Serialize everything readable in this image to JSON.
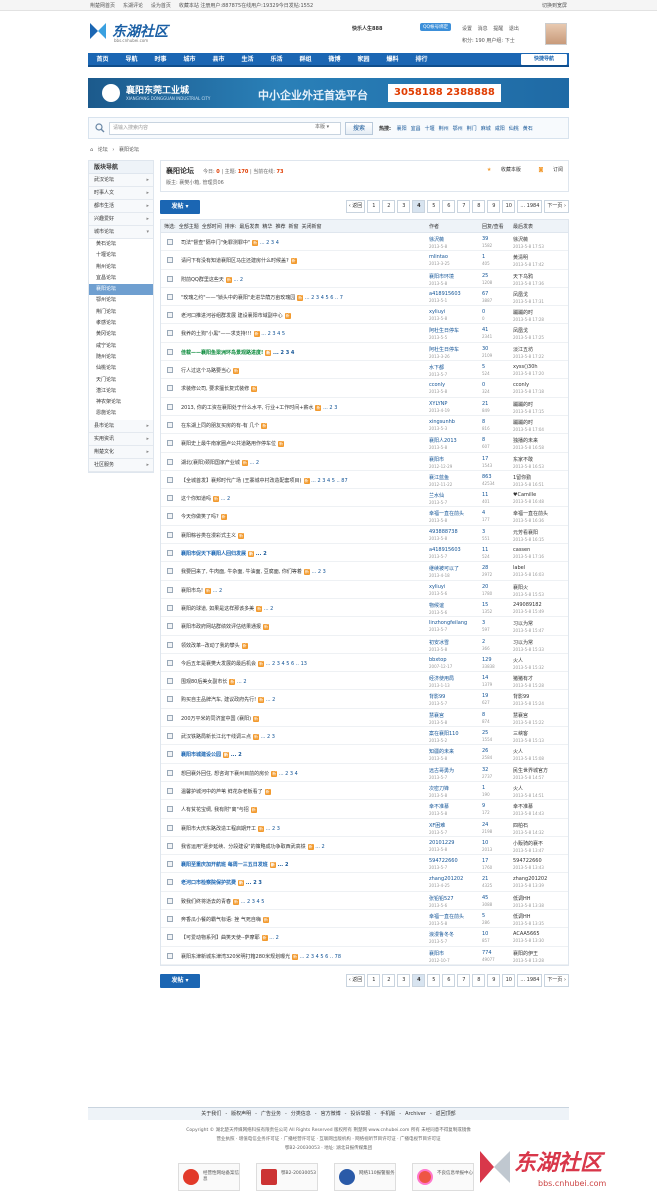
{
  "topbar": {
    "links": [
      "荆楚网首页",
      "东湖评论",
      "设为首页",
      "收藏本站 注册用户:887875在线用户:19329今日发帖:1552"
    ],
    "right": "切换到宽屏"
  },
  "logo": {
    "brand": "东湖社区",
    "sub": "bbs.cnhubei.com"
  },
  "user": {
    "name": "快乐人生888",
    "qq": "QQ帐号绑定",
    "links": [
      "设置",
      "消息",
      "提醒",
      "退出"
    ],
    "score": "积分: 190",
    "group": "用户组: 下士"
  },
  "nav": {
    "items": [
      "首页",
      "导航",
      "时事",
      "城市",
      "县市",
      "生活",
      "乐活",
      "群组",
      "微博",
      "家园",
      "爆料",
      "排行"
    ],
    "quick": "快捷导航"
  },
  "banner": {
    "name": "襄阳东莞工业城",
    "name_en": "XIANGYANG DONGGUAN INDUSTRIAL CITY",
    "slogan": "中小企业外迁首选平台",
    "phone": "3058188 2388888"
  },
  "search": {
    "placeholder": "请输入搜索内容",
    "scope": "本版",
    "button": "搜索",
    "hot_label": "热搜:",
    "hot": [
      "襄阳",
      "宜昌",
      "十堰",
      "荆州",
      "鄂州",
      "荆门",
      "麻城",
      "咸阳",
      "仙桃",
      "黄石"
    ]
  },
  "breadcrumb": [
    "论坛",
    "›",
    "襄阳论坛"
  ],
  "sidebar": {
    "title": "版块导航",
    "groups": [
      "武汉论坛",
      "时事人文",
      "都市生活",
      "兴趣爱好",
      "城市论坛"
    ],
    "subs": [
      "黄石论坛",
      "十堰论坛",
      "荆州论坛",
      "宜昌论坛",
      "襄阳论坛",
      "鄂州论坛",
      "荆门论坛",
      "孝感论坛",
      "黄冈论坛",
      "咸宁论坛",
      "随州论坛",
      "仙桃论坛",
      "天门论坛",
      "潜江论坛",
      "神农架论坛",
      "恩施论坛"
    ],
    "groups2": [
      "县市论坛",
      "实用资讯",
      "荆楚文化",
      "社区服务"
    ]
  },
  "forum": {
    "title": "襄阳论坛",
    "today_label": "今日:",
    "today": "0",
    "topics_label": "主题:",
    "topics": "170",
    "online_label": "当前在线:",
    "online": "73",
    "mods": "版主: 襄樊小箱, 管理员06",
    "fav": "收藏本版",
    "rss": "订阅"
  },
  "actions": {
    "post": "发帖",
    "pager": [
      "‹ 返回",
      "1",
      "2",
      "3",
      "4",
      "5",
      "6",
      "7",
      "8",
      "9",
      "10",
      "... 1984",
      "下一页 ›"
    ],
    "current_page": "4"
  },
  "thead": {
    "filters": [
      "筛选:",
      "全部主题",
      "全部时间",
      "排序:",
      "最后发表",
      "精华",
      "推荐",
      "新窗"
    ],
    "close": "关闭新窗",
    "author": "作者",
    "reply": "回复/查看",
    "last": "最后发表"
  },
  "threads": [
    {
      "title": "司法\"督查\"隔中门\"免罪测罪中\"",
      "pages": "... 2  3  4",
      "style": "",
      "author": "徐沢薇",
      "date": "2013-5-8",
      "replies": "39",
      "views": "1582",
      "last": "徐沢薇",
      "last_date": "2013-5-8 17:53"
    },
    {
      "title": "请问下有没有知道襄阳区马庄还建房什么时候盖?",
      "pages": "",
      "style": "",
      "author": "mlintao",
      "date": "2013-3-25",
      "replies": "1",
      "views": "405",
      "last": "黄清明",
      "last_date": "2013-5-8 17:42"
    },
    {
      "title": "附前QQ群里这些天",
      "pages": "... 2",
      "style": "",
      "author": "襄阳市环境",
      "date": "2013-5-8",
      "replies": "25",
      "views": "1208",
      "last": "天下乌鸦",
      "last_date": "2013-5-8 17:36"
    },
    {
      "title": "\"玫瑰之约\"——\"锁头中的襄阳\"走进华荫万亩玫瑰园",
      "pages": "... 2  3  4  5  6 .. 7",
      "style": "",
      "author": "a418915603",
      "date": "2013-5-1",
      "replies": "67",
      "views": "3887",
      "last": "凤凰戈",
      "last_date": "2013-5-8 17:31"
    },
    {
      "title": "老河口推进河谷组群发展 建设襄阳市域副中心",
      "pages": "",
      "style": "",
      "author": "xyliuyi",
      "date": "2013-5-8",
      "replies": "0",
      "views": "0",
      "last": "蹦蹦的时",
      "last_date": "2013-5-8 17:28"
    },
    {
      "title": "我养的土狗\"小黑\"——求支持!!!",
      "pages": "... 2  3  4  5",
      "style": "",
      "author": "阿杜生日停车",
      "date": "2013-5-5",
      "replies": "41",
      "views": "2341",
      "last": "凤凰戈",
      "last_date": "2013-5-8 17:25"
    },
    {
      "title": "佳载——襄阳鱼梁洲环岛景观路进度!",
      "pages": "... 2  3  4",
      "style": "hl",
      "author": "阿杜生日停车",
      "date": "2013-3-26",
      "replies": "30",
      "views": "2109",
      "last": "淡江五坊",
      "last_date": "2013-5-8 17:22"
    },
    {
      "title": "行人过这个马路要当心",
      "pages": "",
      "style": "",
      "author": "水下都",
      "date": "2013-5-7",
      "replies": "5",
      "views": "524",
      "last": "xyss()30h",
      "last_date": "2013-5-8 17:20"
    },
    {
      "title": "求装修公司, 要求擅长复式装修",
      "pages": "",
      "style": "",
      "author": "cconly",
      "date": "2013-5-8",
      "replies": "0",
      "views": "324",
      "last": "cconly",
      "last_date": "2013-5-8 17:18"
    },
    {
      "title": "2013, 你的工资在襄阳处于什么水平, 行业+工作时间+薪水",
      "pages": "... 2  3",
      "style": "",
      "author": "XYLYNP",
      "date": "2013-4-19",
      "replies": "21",
      "views": "849",
      "last": "蹦蹦的时",
      "last_date": "2013-5-8 17:15"
    },
    {
      "title": "在东湖上同的朋友买房的有-有 几个",
      "pages": "",
      "style": "",
      "author": "xingsunhb",
      "date": "2013-5-3",
      "replies": "8",
      "views": "816",
      "last": "蹦蹦的时",
      "last_date": "2013-5-8 17:04"
    },
    {
      "title": "襄阳史上最牛南家圈卢公共道路用作停车位",
      "pages": "",
      "style": "",
      "author": "襄阳人2013",
      "date": "2013-5-8",
      "replies": "8",
      "views": "607",
      "last": "独播的未来",
      "last_date": "2013-5-8 16:58"
    },
    {
      "title": "湖北(襄阳)颈阳国家产业城",
      "pages": "... 2",
      "style": "",
      "author": "襄阳市",
      "date": "2012-12-29",
      "replies": "17",
      "views": "1543",
      "last": "东家不敢",
      "last_date": "2013-5-8 16:53"
    },
    {
      "title": "【全城首发】襄邦时代广场 (王寨城中村改造配套项目)",
      "pages": "... 2  3  4  5 .. 87",
      "style": "",
      "author": "襄江蓝鱼",
      "date": "2012-11-22",
      "replies": "863",
      "views": "42534",
      "last": "1留你勤",
      "last_date": "2013-5-8 16:51"
    },
    {
      "title": "这个你知道吗",
      "pages": "... 2",
      "style": "",
      "author": "兰水仙",
      "date": "2013-5-7",
      "replies": "11",
      "views": "401",
      "last": "♥Camille",
      "last_date": "2013-5-8 16:48"
    },
    {
      "title": "今天你做笑了吗?",
      "pages": "",
      "style": "",
      "author": "幸福一直在前头",
      "date": "2013-5-8",
      "replies": "4",
      "views": "177",
      "last": "幸福一直在前头",
      "last_date": "2013-5-8 16:36"
    },
    {
      "title": "襄阳粽谷类在漫彩式主义",
      "pages": "",
      "style": "",
      "author": "493888738",
      "date": "2013-5-8",
      "replies": "3",
      "views": "551",
      "last": "元芳看襄阳",
      "last_date": "2013-5-8 16:15"
    },
    {
      "title": "襄阳市促天下襄阳人回归发展",
      "pages": "... 2",
      "style": "bl",
      "author": "a418915603",
      "date": "2013-5-7",
      "replies": "11",
      "views": "524",
      "last": "cassen",
      "last_date": "2013-5-8 17:16"
    },
    {
      "title": "我要回来了, 牛肉面, 牛杂面, 牛油面, 豆腐面, 你们等着",
      "pages": "... 2  3",
      "style": "",
      "author": "继续被可以了",
      "date": "2013-4-18",
      "replies": "28",
      "views": "2972",
      "last": "label",
      "last_date": "2013-5-8 16:03"
    },
    {
      "title": "襄阳市鸟!",
      "pages": "... 2",
      "style": "",
      "author": "xyliuyi",
      "date": "2013-5-6",
      "replies": "20",
      "views": "1780",
      "last": "襄阳火",
      "last_date": "2013-5-8 15:53"
    },
    {
      "title": "襄阳的球道, 如果是这样那该多美",
      "pages": "... 2",
      "style": "",
      "author": "物候谊",
      "date": "2013-5-6",
      "replies": "15",
      "views": "1352",
      "last": "249089182",
      "last_date": "2013-5-8 15:49"
    },
    {
      "title": "襄阳市政府网站群绩效评估结果通报",
      "pages": "",
      "style": "",
      "author": "linzhongfeilang",
      "date": "2013-5-7",
      "replies": "3",
      "views": "597",
      "last": "习以为常",
      "last_date": "2013-5-8 15:47"
    },
    {
      "title": "领效改革--改动了我的攀头",
      "pages": "",
      "style": "",
      "author": "初安冰雪",
      "date": "2013-5-8",
      "replies": "2",
      "views": "366",
      "last": "习以为常",
      "last_date": "2013-5-8 15:33"
    },
    {
      "title": "今后五年是襄樊大发展的最后机会",
      "pages": "... 2  3  4  5  6 .. 13",
      "style": "",
      "author": "bbxtop",
      "date": "2007-12-17",
      "replies": "129",
      "views": "33838",
      "last": "火人",
      "last_date": "2013-5-8 15:32"
    },
    {
      "title": "围观80后美女副市长",
      "pages": "... 2",
      "style": "",
      "author": "经济使用局",
      "date": "2013-1-13",
      "replies": "14",
      "views": "1379",
      "last": "猪猪有才",
      "last_date": "2013-5-8 15:28"
    },
    {
      "title": "购买自主品牌汽车, 建议政府先行!",
      "pages": "... 2",
      "style": "",
      "author": "背影99",
      "date": "2013-5-7",
      "replies": "19",
      "views": "627",
      "last": "背影99",
      "last_date": "2013-5-8 15:24"
    },
    {
      "title": "200万平米的同济室中国 (襄阳)",
      "pages": "",
      "style": "",
      "author": "慧襄宫",
      "date": "2013-5-8",
      "replies": "8",
      "views": "874",
      "last": "慧襄宫",
      "last_date": "2013-5-8 15:22"
    },
    {
      "title": "武汉铁路局新长江北干线调三点",
      "pages": "... 2  3",
      "style": "",
      "author": "案在襄阳110",
      "date": "2013-5-2",
      "replies": "25",
      "views": "1554",
      "last": "三峡客",
      "last_date": "2013-5-8 15:13"
    },
    {
      "title": "襄阳市城建设公园",
      "pages": "... 2",
      "style": "bl",
      "author": "知疆的未来",
      "date": "2013-5-8",
      "replies": "26",
      "views": "2584",
      "last": "火人",
      "last_date": "2013-5-8 15:08"
    },
    {
      "title": "想回襄外回住, 想咨询下襄州目前的房价",
      "pages": "... 2  3  4",
      "style": "",
      "author": "远古哥勇为",
      "date": "2013-5-7",
      "replies": "32",
      "views": "2737",
      "last": "民生世界城官方",
      "last_date": "2013-5-8 14:57"
    },
    {
      "title": "温馨护城河中的芦苇 鲜花杂老板看了",
      "pages": "",
      "style": "",
      "author": "次密刀锋",
      "date": "2013-5-8",
      "replies": "1",
      "views": "190",
      "last": "火人",
      "last_date": "2013-5-8 14:51"
    },
    {
      "title": "人有贫花宝绸, 我有附\"离\"与招",
      "pages": "",
      "style": "",
      "author": "幸不准慕",
      "date": "2013-5-8",
      "replies": "9",
      "views": "172",
      "last": "幸不准慕",
      "last_date": "2013-5-8 14:43"
    },
    {
      "title": "襄阳市大庆东路改造工程启期开工",
      "pages": "... 2  3",
      "style": "",
      "author": "XF困难",
      "date": "2013-5-7",
      "replies": "24",
      "views": "2198",
      "last": "四柏石",
      "last_date": "2013-5-8 14:32"
    },
    {
      "title": "我省运用\"逐步延续、分段建设\"的策略成功争取西武高铁",
      "pages": "... 2",
      "style": "",
      "author": "20101229",
      "date": "2013-5-8",
      "replies": "10",
      "views": "2013",
      "last": "小贩骑的襄不",
      "last_date": "2013-5-8 13:47"
    },
    {
      "title": "襄阳至重庆加开航班 每周一三五日发班",
      "pages": "... 2",
      "style": "bl",
      "author": "594722660",
      "date": "2013-5-7",
      "replies": "17",
      "views": "1760",
      "last": "594722660",
      "last_date": "2013-5-8 13:43"
    },
    {
      "title": "老河口市检察院保护抗费",
      "pages": "... 2  3",
      "style": "bld",
      "author": "zhang201202",
      "date": "2013-4-25",
      "replies": "21",
      "views": "4325",
      "last": "zhang201202",
      "last_date": "2013-5-8 13:39"
    },
    {
      "title": "致我们终将逝去的青春",
      "pages": "... 2  3  4  5",
      "style": "",
      "author": "张铅铅527",
      "date": "2013-5-6",
      "replies": "45",
      "views": "3088",
      "last": "低调HH",
      "last_date": "2013-5-8 13:38"
    },
    {
      "title": "奔香瓜小餐的霸气标语: 挫 气死自嗨",
      "pages": "",
      "style": "",
      "author": "幸福一直在前头",
      "date": "2013-5-8",
      "replies": "5",
      "views": "286",
      "last": "低调HH",
      "last_date": "2013-5-8 13:35"
    },
    {
      "title": "【可爱动物系列】曲笑天使--萨摩耶",
      "pages": "... 2",
      "style": "",
      "author": "浪漫鲁冬冬",
      "date": "2013-5-7",
      "replies": "10",
      "views": "857",
      "last": "ACAA5665",
      "last_date": "2013-5-8 13:30"
    },
    {
      "title": "襄阳东津新城东津湾320米明打箱280米规划曝光",
      "pages": "... 2  3  4  5  6 .. 78",
      "style": "",
      "author": "襄阳市",
      "date": "2012-10-7",
      "replies": "774",
      "views": "49077",
      "last": "襄阳的伊王",
      "last_date": "2013-5-8 13:28"
    }
  ],
  "footer": {
    "links": [
      "关于我们",
      "-",
      "版权声明",
      "-",
      "广告业务",
      "-",
      "分类信息",
      "-",
      "官方微博",
      "-",
      "投诉举报",
      "-",
      "手机版",
      "-",
      "Archiver",
      "-",
      "返回顶部"
    ],
    "copy1": "Copyright © 湖北楚天传媒网络科技有限责任公司 All Rights Reserved 版权所有 荆楚网 www.cnhubei.com 所有 未经同意不得复制或镜像",
    "copy2": "营业执照 · 增值电信业务许可证 · 广播经营许可证 · 互联网出版机构 · 网络视听节目许可证 · 广播电视节目许可证",
    "copy3": "鄂B2-20030053 · 地址: 湖北日报传媒集团"
  },
  "badges": [
    "经营性网站备案信息",
    "鄂B2-20030053",
    "网络110报警服务",
    "不良信息举报中心"
  ],
  "watermark": {
    "brand": "东湖社区",
    "url": "bbs.cnhubei.com"
  },
  "colors": {
    "primary": "#1b66b3",
    "accent": "#e03c00",
    "highlight": "#0a8a3a"
  }
}
